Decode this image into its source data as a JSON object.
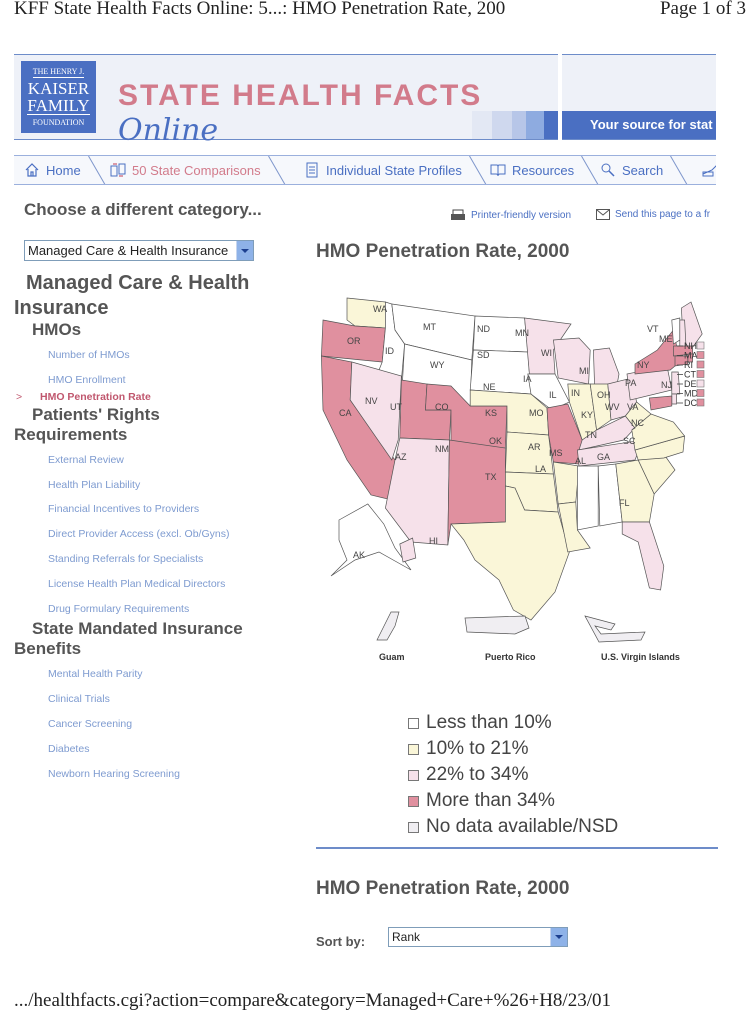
{
  "print": {
    "header_title": "KFF State Health Facts Online: 5...: HMO Penetration Rate, 200",
    "page_indicator": "Page 1 of 3",
    "footer_url": ".../healthfacts.cgi?action=compare&category=Managed+Care+%26+H8/23/01"
  },
  "banner": {
    "logo_line1": "THE HENRY J.",
    "logo_line2": "KAISER",
    "logo_line3": "FAMILY",
    "logo_line4": "FOUNDATION",
    "brand_main": "STATE HEALTH FACTS",
    "brand_script": "Online",
    "tagline": "Your source for stat",
    "colors": {
      "blue": "#4a6fc2",
      "pink": "#d27b8b",
      "background": "#eef1f8"
    }
  },
  "nav": {
    "tabs": [
      {
        "label": "Home",
        "icon": "home-icon",
        "active": false
      },
      {
        "label": "50 State Comparisons",
        "icon": "compare-icon",
        "active": true
      },
      {
        "label": "Individual State Profiles",
        "icon": "document-icon",
        "active": false
      },
      {
        "label": "Resources",
        "icon": "book-icon",
        "active": false
      },
      {
        "label": "Search",
        "icon": "magnifier-icon",
        "active": false
      },
      {
        "label": "",
        "icon": "pen-icon",
        "active": false
      }
    ]
  },
  "sidebar": {
    "choose_label": "Choose a different category...",
    "category_select": {
      "value": "Managed Care & Health Insurance"
    },
    "section_title": "Managed Care & Health Insurance",
    "groups": [
      {
        "title": "HMOs",
        "items": [
          {
            "label": "Number of HMOs",
            "active": false
          },
          {
            "label": "HMO Enrollment",
            "active": false
          },
          {
            "label": "HMO Penetration Rate",
            "active": true
          }
        ]
      },
      {
        "title": "Patients' Rights Requirements",
        "items": [
          {
            "label": "External Review"
          },
          {
            "label": "Health Plan Liability"
          },
          {
            "label": "Financial Incentives to Providers"
          },
          {
            "label": "Direct Provider Access (excl. Ob/Gyns)"
          },
          {
            "label": "Standing Referrals for Specialists"
          },
          {
            "label": "License Health Plan Medical Directors"
          },
          {
            "label": "Drug Formulary Requirements"
          }
        ]
      },
      {
        "title": "State Mandated Insurance Benefits",
        "items": [
          {
            "label": "Mental Health Parity"
          },
          {
            "label": "Clinical Trials"
          },
          {
            "label": "Cancer Screening"
          },
          {
            "label": "Diabetes"
          },
          {
            "label": "Newborn Hearing Screening"
          }
        ]
      }
    ],
    "active_marker": ">"
  },
  "utility": {
    "printer_friendly": "Printer-friendly version",
    "send_page": "Send this page to a fr"
  },
  "main": {
    "title": "HMO Penetration Rate, 2000",
    "map": {
      "categories": [
        {
          "key": "lt10",
          "label": "Less than 10%",
          "color": "#ffffff"
        },
        {
          "key": "10to21",
          "label": "10% to 21%",
          "color": "#faf6d8"
        },
        {
          "key": "22to34",
          "label": "22% to 34%",
          "color": "#f6e1ea"
        },
        {
          "key": "gt34",
          "label": "More than 34%",
          "color": "#e0909f"
        },
        {
          "key": "nodata",
          "label": "No data available/NSD",
          "color": "#f0eef2"
        }
      ],
      "states": {
        "WA": "10to21",
        "OR": "gt34",
        "CA": "gt34",
        "ID": "lt10",
        "NV": "22to34",
        "MT": "lt10",
        "WY": "lt10",
        "UT": "gt34",
        "AZ": "22to34",
        "CO": "gt34",
        "NM": "gt34",
        "ND": "lt10",
        "SD": "lt10",
        "NE": "10to21",
        "KS": "10to21",
        "OK": "10to21",
        "TX": "10to21",
        "MN": "22to34",
        "IA": "lt10",
        "MO": "gt34",
        "AR": "10to21",
        "LA": "10to21",
        "WI": "22to34",
        "IL": "10to21",
        "MS": "lt10",
        "MI": "22to34",
        "IN": "10to21",
        "OH": "22to34",
        "KY": "22to34",
        "TN": "22to34",
        "AL": "lt10",
        "GA": "10to21",
        "FL": "22to34",
        "SC": "10to21",
        "NC": "10to21",
        "VA": "10to21",
        "WV": "10to21",
        "PA": "22to34",
        "NY": "gt34",
        "VT": "lt10",
        "ME": "22to34",
        "NH": "22to34",
        "MA": "gt34",
        "RI": "gt34",
        "CT": "gt34",
        "NJ": "22to34",
        "DE": "22to34",
        "MD": "gt34",
        "DC": "gt34",
        "AK": "lt10",
        "HI": "22to34"
      },
      "small_state_callouts": [
        "NH",
        "MA",
        "RI",
        "CT",
        "DE",
        "MD",
        "DC"
      ],
      "territories": [
        "Guam",
        "Puerto Rico",
        "U.S. Virgin Islands"
      ]
    },
    "table_title": "HMO Penetration Rate, 2000",
    "sort_label": "Sort by:",
    "sort_select": {
      "value": "Rank"
    }
  }
}
